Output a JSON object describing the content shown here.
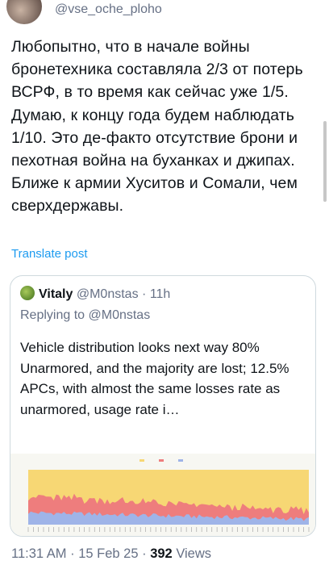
{
  "author": {
    "handle": "@vse_oche_ploho"
  },
  "post": {
    "text": "Любопытно, что в начале войны бронетехника составляла 2/3 от потерь ВСРФ, в то время как сейчас уже 1/5. Думаю, к концу года будем наблюдать 1/10. Это де-факто отсутствие брони и пехотная война на буханках и джипах. Ближе к армии Хуситов и Сомали, чем сверхдержавы.",
    "translate_label": "Translate post"
  },
  "quoted": {
    "name": "Vitaly",
    "handle": "@M0nstas",
    "separator": "·",
    "time": "11h",
    "replying_to": "Replying to @M0nstas",
    "text": "Vehicle distribution looks next way 80% Unarmored, and the majority are lost; 12.5% APCs, with almost the same losses rate as unarmored, usage rate i…",
    "chart_colors": {
      "unarmored": "#f7d774",
      "apc": "#ee7d7d",
      "tank": "#9fb4e8",
      "background": "#f7f7f2"
    }
  },
  "footer": {
    "time": "11:31 AM",
    "separator": "·",
    "date": "15 Feb 25",
    "views_count": "392",
    "views_label": "Views"
  }
}
